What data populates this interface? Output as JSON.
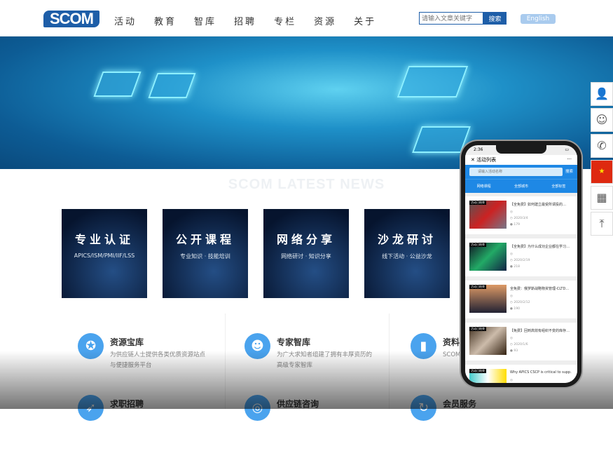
{
  "header": {
    "logo": "SCOM",
    "nav": [
      "活动",
      "教育",
      "智库",
      "招聘",
      "专栏",
      "资源",
      "关于"
    ],
    "search_placeholder": "请输入文章关键字",
    "search_button": "搜索",
    "english": "English"
  },
  "news_title": "SCOM LATEST NEWS",
  "cards": [
    {
      "title": "专业认证",
      "sub": "APICS/ISM/PMI/IIF/LSS"
    },
    {
      "title": "公开课程",
      "sub": "专业知识 · 技能培训"
    },
    {
      "title": "网络分享",
      "sub": "网络研讨 · 知识分享"
    },
    {
      "title": "沙龙研讨",
      "sub": "线下活动 · 公益沙龙"
    }
  ],
  "features": [
    {
      "title": "资源宝库",
      "desc": "为供应链人士提供各类优质资源站点与便捷服务平台",
      "icon": "medal-icon"
    },
    {
      "title": "专家智库",
      "desc": "为广大求知者组建了拥有丰厚资历的高级专家智库",
      "icon": "expert-icon"
    },
    {
      "title": "资料",
      "desc": "SCOM 精品文",
      "icon": "book-icon"
    },
    {
      "title": "求职招聘",
      "desc": "",
      "icon": "rocket-icon"
    },
    {
      "title": "供应链咨询",
      "desc": "",
      "icon": "consult-icon"
    },
    {
      "title": "会员服务",
      "desc": "",
      "icon": "refresh-icon"
    }
  ],
  "side": [
    "user-icon",
    "service-icon",
    "phone-icon",
    "china-flag-icon",
    "qrcode-icon",
    "back-to-top-icon"
  ],
  "phone": {
    "time": "2:36",
    "title": "活动列表",
    "more": "···",
    "search_placeholder": "请输入活动名称",
    "search_button": "搜索",
    "tabs": [
      "网络课程",
      "全部城市",
      "全部标签"
    ],
    "items": [
      {
        "tag": "活动已结束",
        "title": "【全免费】如何建立最受所谓投的…",
        "date": "2020/3/4",
        "count": "179"
      },
      {
        "tag": "活动已结束",
        "title": "【全免费】为什么成功企业都在学习…",
        "date": "2020/2/19",
        "count": "218"
      },
      {
        "tag": "活动已结束",
        "title": "全免费：俄罗斯战略物资管理-CLTD…",
        "date": "2020/2/12",
        "count": "190"
      },
      {
        "tag": "活动已结束",
        "title": "【免费】回到高效有组织不变的库存…",
        "date": "2020/1/6",
        "count": "93"
      },
      {
        "tag": "活动已结束",
        "title": "Why APICS CSCP is critical to supp…",
        "date": "",
        "count": "",
        "img_text": "Learning"
      }
    ]
  }
}
